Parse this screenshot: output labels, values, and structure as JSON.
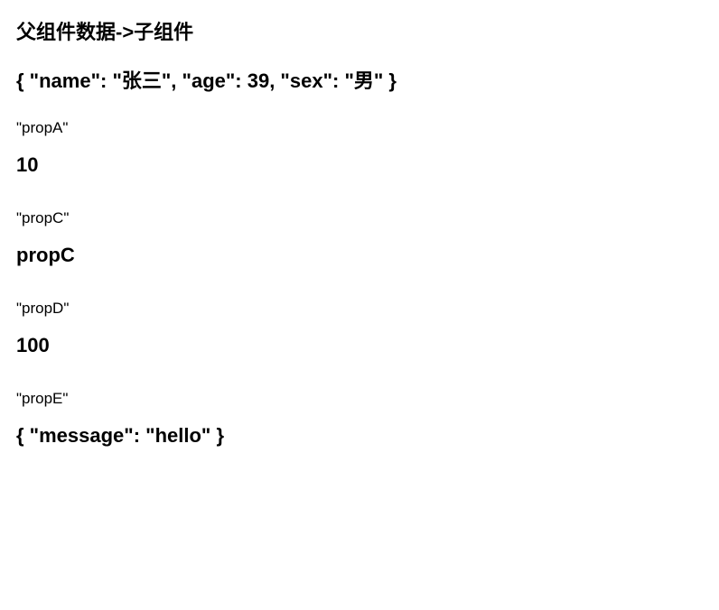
{
  "title": "父组件数据->子组件",
  "headerObject": "{ \"name\": \"张三\", \"age\": 39, \"sex\": \"男\" }",
  "propA": {
    "label": "\"propA\"",
    "value": "10"
  },
  "propC": {
    "label": "\"propC\"",
    "value": "propC"
  },
  "propD": {
    "label": "\"propD\"",
    "value": "100"
  },
  "propE": {
    "label": "\"propE\"",
    "value": "{ \"message\": \"hello\" }"
  }
}
